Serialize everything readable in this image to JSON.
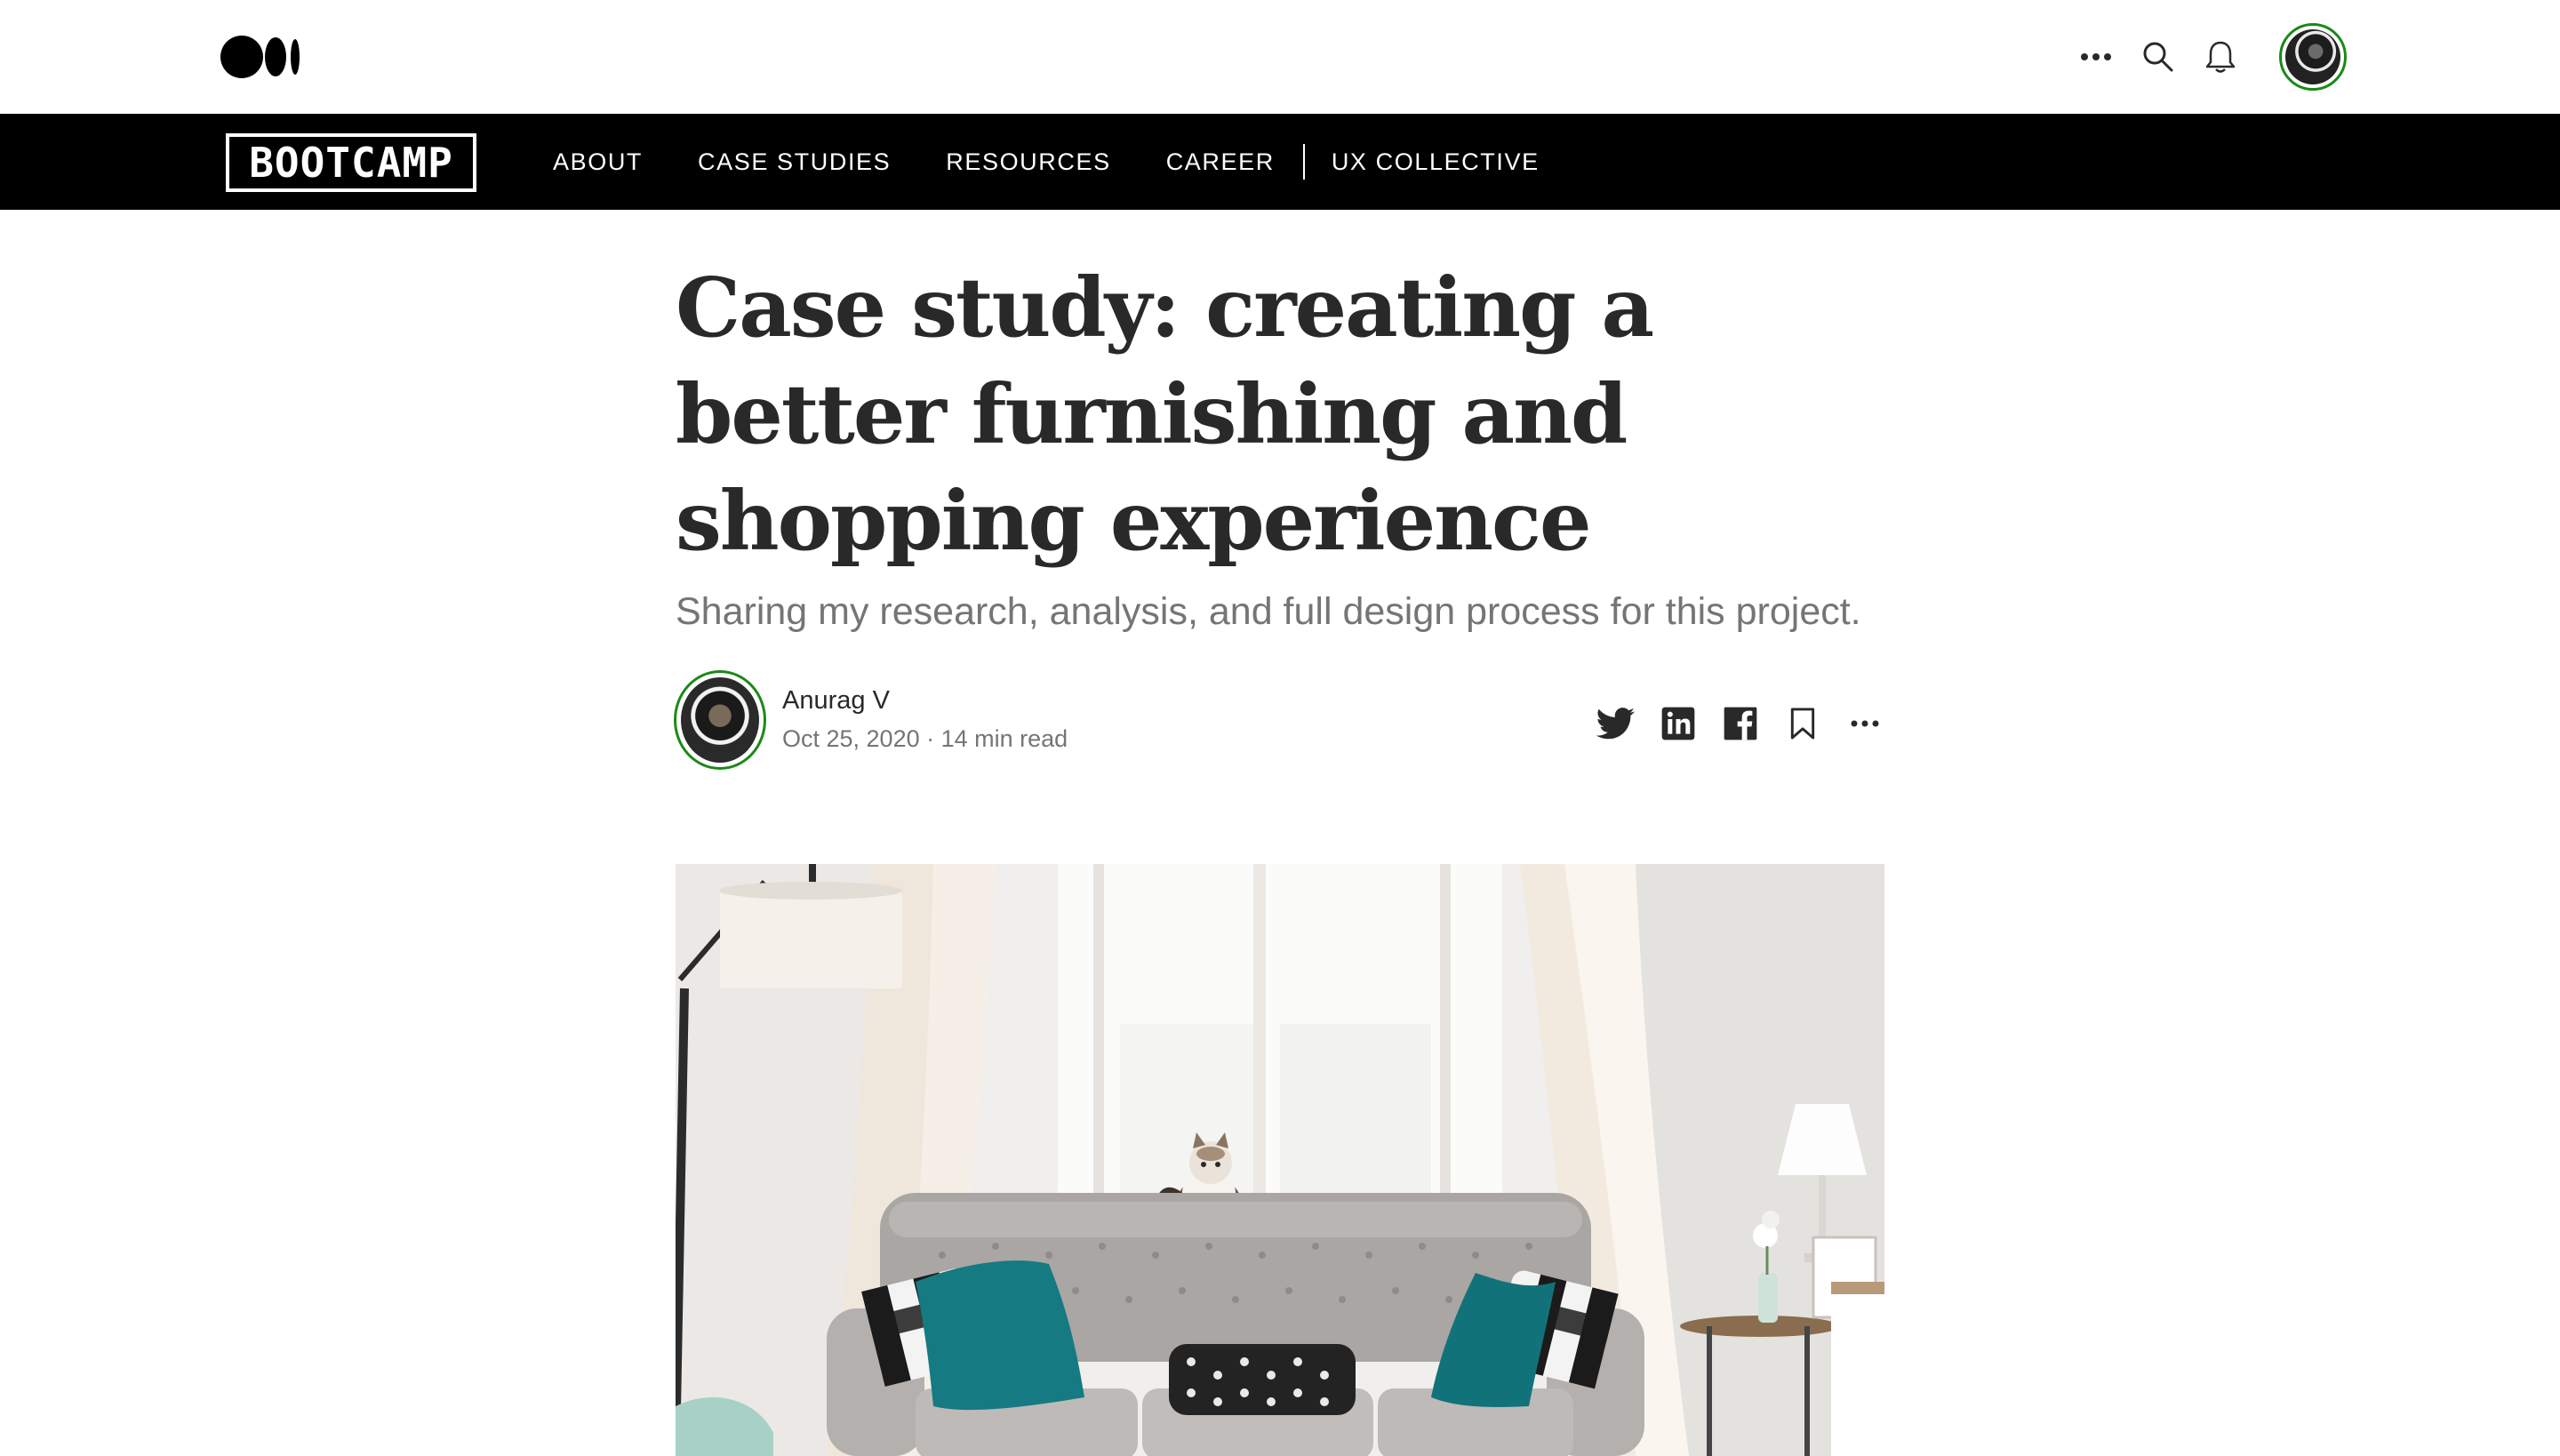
{
  "topbar": {
    "logo_icon": "medium-logo-icon",
    "icons": [
      "more-icon",
      "search-icon",
      "bell-icon"
    ],
    "avatar": "user-avatar"
  },
  "nav": {
    "brand": "BOOTCAMP",
    "items": [
      {
        "label": "ABOUT"
      },
      {
        "label": "CASE STUDIES"
      },
      {
        "label": "RESOURCES"
      },
      {
        "label": "CAREER"
      },
      {
        "label": "UX COLLECTIVE"
      }
    ]
  },
  "article": {
    "title": "Case study: creating a better furnishing and shopping experience",
    "subtitle": "Sharing my research, analysis, and full design process for this project.",
    "author": {
      "name": "Anurag V",
      "meta": "Oct 25, 2020 · 14 min read"
    },
    "share_icons": [
      "twitter-icon",
      "linkedin-icon",
      "facebook-icon",
      "bookmark-icon",
      "more-icon"
    ],
    "hero_image": "living-room-sofa-with-teal-pillows-and-cat"
  },
  "colors": {
    "accent_green": "#1a8917",
    "nav_bg": "#000000",
    "text": "#292929",
    "muted": "#757575",
    "teal": "#157a82"
  }
}
